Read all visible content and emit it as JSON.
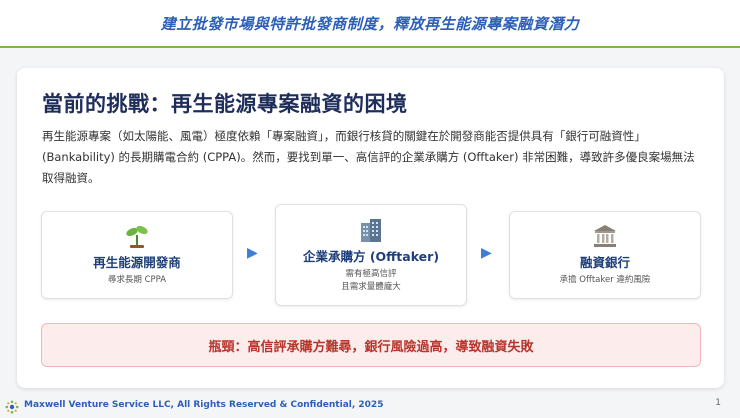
{
  "header": {
    "title": "建立批發市場與特許批發商制度，釋放再生能源專案融資潛力"
  },
  "card": {
    "heading": "當前的挑戰：再生能源專案融資的困境",
    "paragraph": "再生能源專案（如太陽能、風電）極度依賴「專案融資」，而銀行核貸的關鍵在於開發商能否提供具有「銀行可融資性」(Bankability) 的長期購電合約 (CPPA)。然而，要找到單一、高信評的企業承購方 (Offtaker) 非常困難，導致許多優良案場無法取得融資。",
    "flow": [
      {
        "icon": "seedling-icon",
        "label": "再生能源開發商",
        "sub": "尋求長期 CPPA"
      },
      {
        "icon": "office-building-icon",
        "label": "企業承購方 (Offtaker)",
        "sub1": "需有極高信評",
        "sub2": "且需求量體龐大"
      },
      {
        "icon": "bank-icon",
        "label": "融資銀行",
        "sub": "承擔 Offtaker 違約風險"
      }
    ],
    "alert": "瓶頸：高信評承購方難尋，銀行風險過高，導致融資失敗"
  },
  "footer": {
    "company": "Maxwell Venture Service LLC, All Rights Reserved & Confidential, 2025",
    "page_number": "1"
  },
  "colors": {
    "accent_blue": "#2d5fb8",
    "divider_green": "#7ab648",
    "alert_red": "#b8352c",
    "alert_bg": "#fdecec"
  }
}
